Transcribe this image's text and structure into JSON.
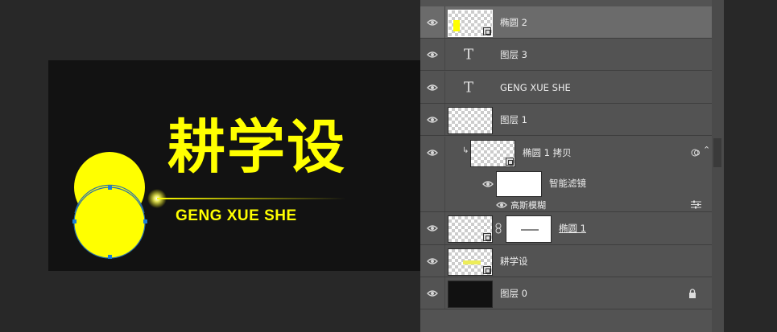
{
  "canvas": {
    "logo_cn": "耕学设",
    "logo_en": "GENG XUE SHE",
    "colors": {
      "background": "#121212",
      "logo": "#ffff00",
      "selection": "#1e7fd6"
    }
  },
  "layers_panel": {
    "layers": [
      {
        "name": "椭圆 2",
        "kind": "smart-object",
        "selected": true,
        "visible": true
      },
      {
        "name": "图层 3",
        "kind": "text",
        "visible": true
      },
      {
        "name": "GENG XUE SHE",
        "kind": "text",
        "visible": true
      },
      {
        "name": "图层 1",
        "kind": "pixel",
        "visible": true
      },
      {
        "name": "椭圆 1 拷贝",
        "kind": "smart-object",
        "clipped": true,
        "visible": true
      },
      {
        "name": "智能滤镜",
        "kind": "smart-filter-mask",
        "visible": true
      },
      {
        "name": "高斯模糊",
        "kind": "filter",
        "visible": true
      },
      {
        "name": "椭圆 1",
        "kind": "smart-object-linked-mask",
        "visible": true
      },
      {
        "name": "耕学设",
        "kind": "smart-object",
        "visible": true
      },
      {
        "name": "图层 0",
        "kind": "background",
        "locked": true,
        "visible": true
      }
    ],
    "icons": [
      "eye-icon",
      "type-tool-icon",
      "lock-icon",
      "chain-link-icon",
      "filter-options-icon",
      "clip-arrow-icon"
    ]
  }
}
